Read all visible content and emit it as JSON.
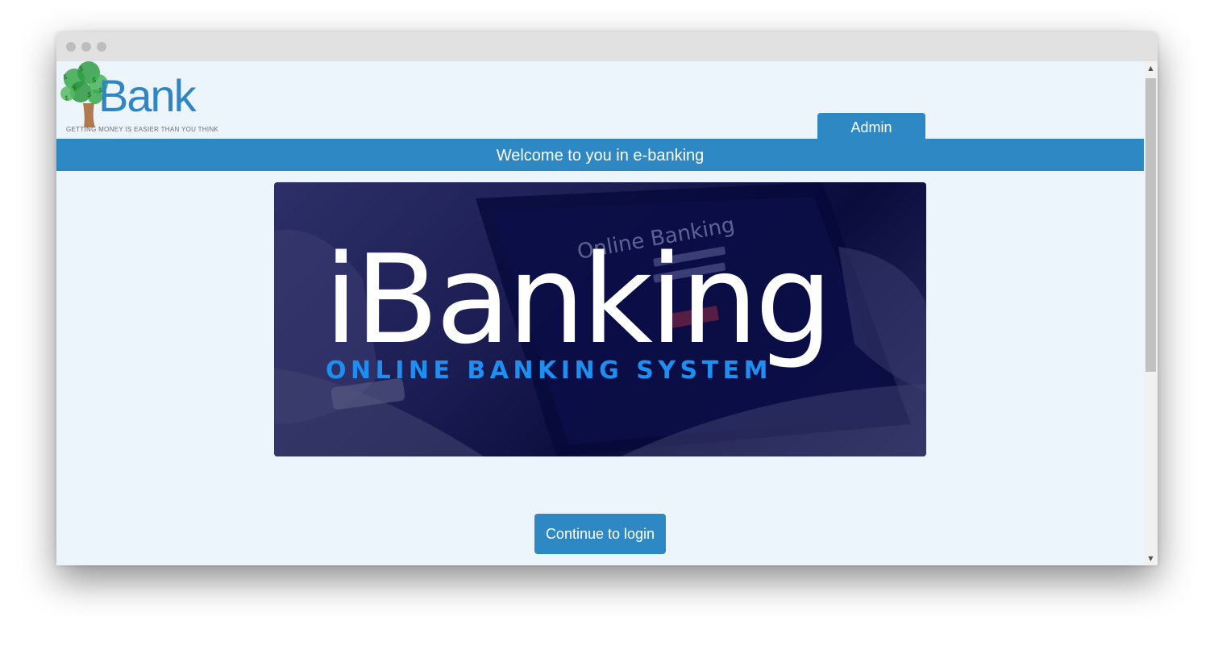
{
  "logo": {
    "brand": "Bank",
    "tagline": "GETTING MONEY IS EASIER THAN YOU THINK"
  },
  "nav": {
    "admin_tab": "Admin"
  },
  "welcome": {
    "text": "Welcome to you in e-banking"
  },
  "banner": {
    "title": "iBanking",
    "subtitle": "ONLINE BANKING SYSTEM",
    "screen_text": "Online Banking"
  },
  "actions": {
    "continue_label": "Continue to login"
  },
  "colors": {
    "accent": "#2e88c4",
    "page_bg": "#ecf4fc",
    "banner_bg": "#1a1c52",
    "banner_subtitle": "#1e8ff0"
  }
}
